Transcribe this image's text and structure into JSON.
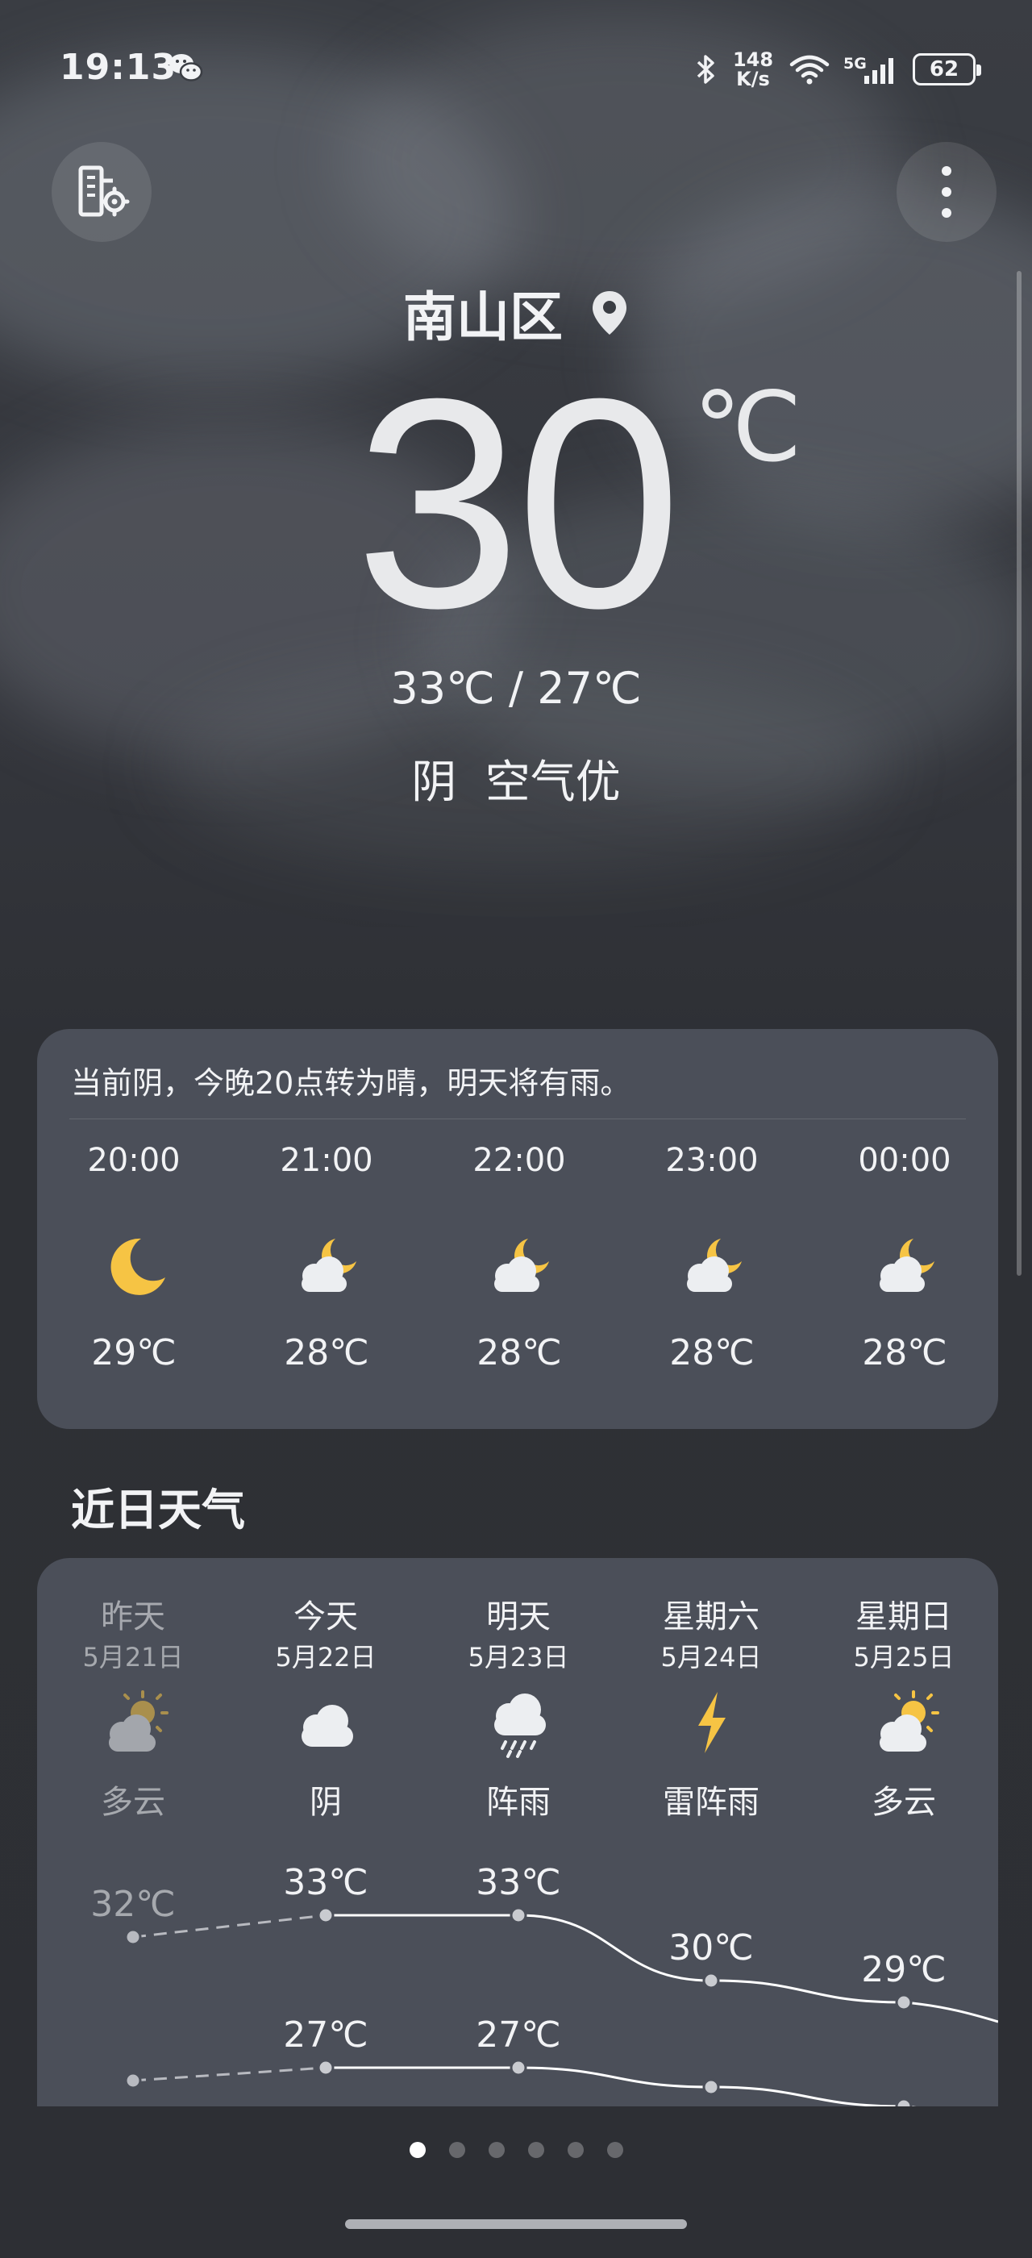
{
  "status_bar": {
    "time": "19:13",
    "network_speed_value": "148",
    "network_speed_unit": "K/s",
    "network_type": "5G",
    "battery": "62",
    "icons": [
      "wechat-icon",
      "bluetooth-icon",
      "wifi-icon",
      "signal-icon",
      "battery-icon"
    ]
  },
  "header": {
    "city_manage_icon": "city-settings-icon",
    "more_icon": "more-vertical-icon"
  },
  "current": {
    "location": "南山区",
    "temperature": "30",
    "unit": "℃",
    "range": "33℃ / 27℃",
    "condition": "阴  空气优"
  },
  "hourly": {
    "summary": "当前阴，今晚20点转为晴，明天将有雨。",
    "items": [
      {
        "time": "20:00",
        "icon": "moon-icon",
        "temp": "29℃"
      },
      {
        "time": "21:00",
        "icon": "partly-cloudy-night-icon",
        "temp": "28℃"
      },
      {
        "time": "22:00",
        "icon": "partly-cloudy-night-icon",
        "temp": "28℃"
      },
      {
        "time": "23:00",
        "icon": "partly-cloudy-night-icon",
        "temp": "28℃"
      },
      {
        "time": "00:00",
        "icon": "partly-cloudy-night-icon",
        "temp": "28℃"
      }
    ]
  },
  "daily": {
    "title": "近日天气",
    "days": [
      {
        "name": "昨天",
        "date": "5月21日",
        "icon": "partly-cloudy-icon",
        "condition": "多云"
      },
      {
        "name": "今天",
        "date": "5月22日",
        "icon": "cloudy-icon",
        "condition": "阴"
      },
      {
        "name": "明天",
        "date": "5月23日",
        "icon": "rain-icon",
        "condition": "阵雨"
      },
      {
        "name": "星期六",
        "date": "5月24日",
        "icon": "thunderstorm-icon",
        "condition": "雷阵雨"
      },
      {
        "name": "星期日",
        "date": "5月25日",
        "icon": "partly-cloudy-icon",
        "condition": "多云"
      }
    ]
  },
  "chart_data": {
    "type": "line",
    "categories": [
      "昨天",
      "今天",
      "明天",
      "星期六",
      "星期日"
    ],
    "series": [
      {
        "values": [
          32,
          33,
          33,
          30,
          29
        ],
        "labels": [
          "32℃",
          "33℃",
          "33℃",
          "30℃",
          "29℃"
        ]
      },
      {
        "values": [
          27,
          27,
          27,
          26,
          25
        ],
        "labels": [
          "",
          "27℃",
          "27℃",
          "",
          ""
        ]
      }
    ],
    "colors": {
      "line": "#ffffff",
      "dim": "#b8bac0"
    }
  },
  "pager": {
    "count": 6,
    "active": 0
  }
}
